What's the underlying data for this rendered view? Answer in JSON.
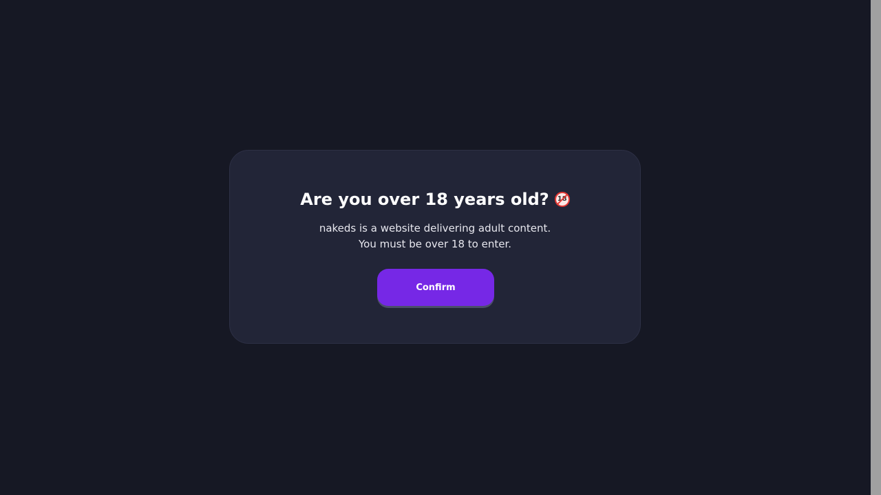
{
  "modal": {
    "title": "Are you over 18 years old?",
    "badge": "18",
    "description_line1": "nakeds is a website delivering adult content.",
    "description_line2": "You must be over 18 to enter.",
    "confirm_label": "Confirm"
  },
  "colors": {
    "background": "#161824",
    "modal": "#222537",
    "accent": "#7628e6",
    "badge_ring": "#e53935"
  },
  "icons": {
    "badge_icon": "no-one-under-eighteen-icon"
  }
}
